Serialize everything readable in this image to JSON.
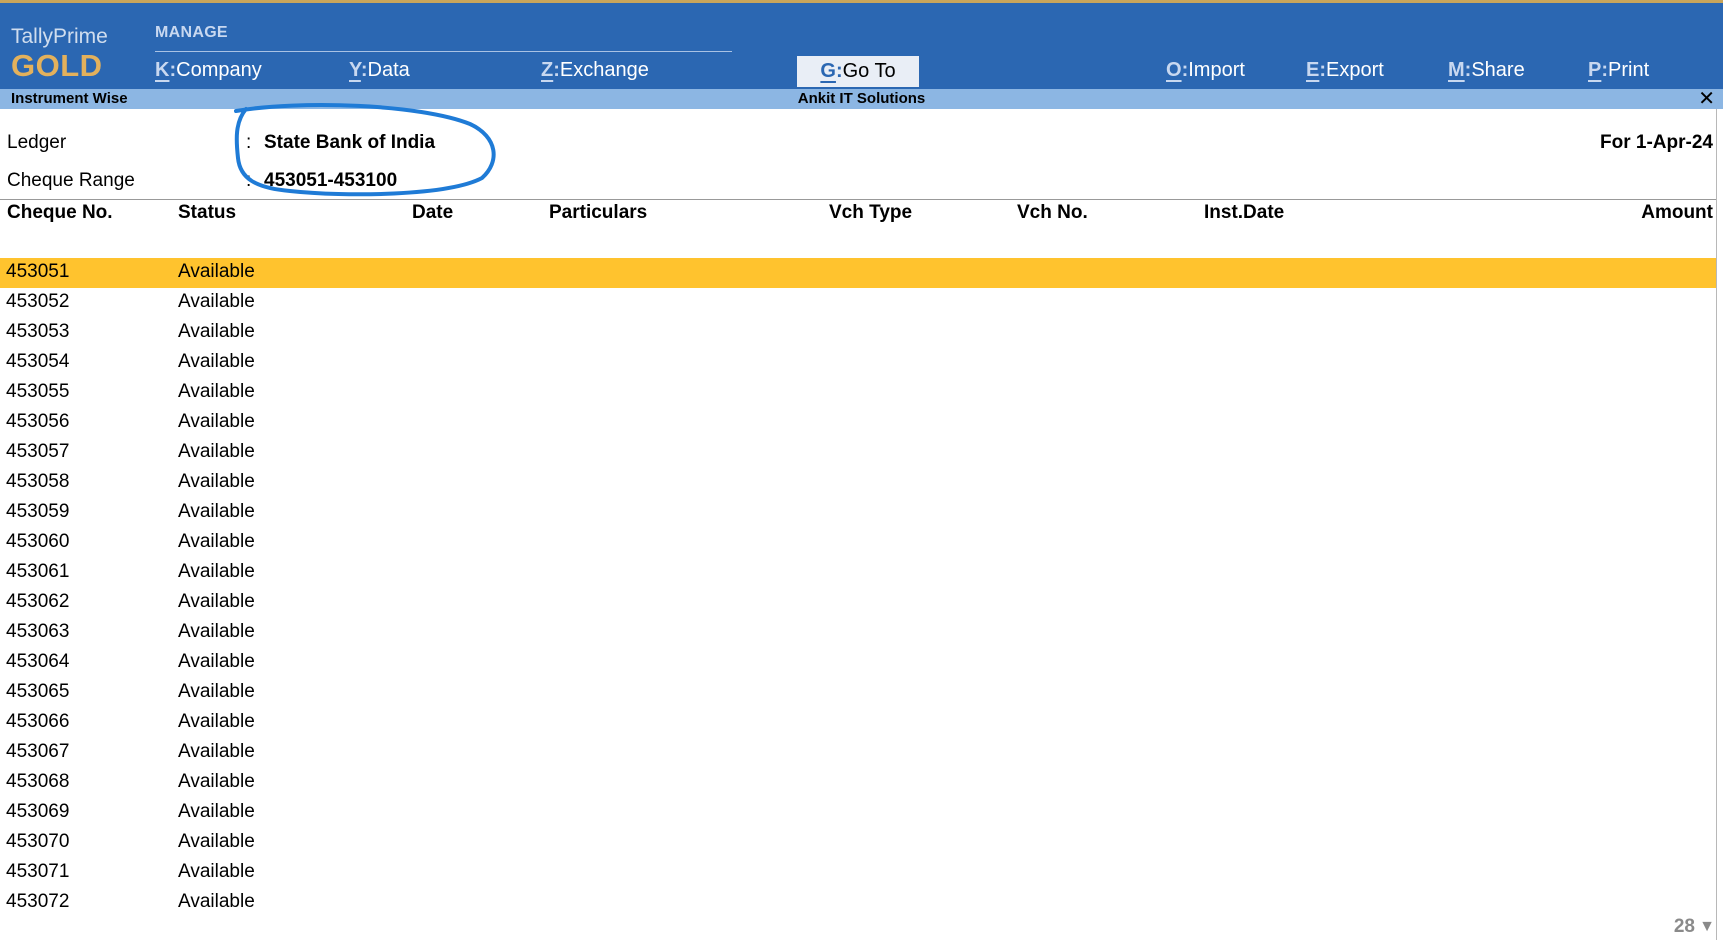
{
  "app": {
    "name": "TallyPrime",
    "edition": "GOLD"
  },
  "menu": {
    "section": "MANAGE",
    "items": [
      {
        "key": "K",
        "label": "Company"
      },
      {
        "key": "Y",
        "label": "Data"
      },
      {
        "key": "Z",
        "label": "Exchange"
      },
      {
        "key": "G",
        "label": "Go To"
      },
      {
        "key": "O",
        "label": "Import"
      },
      {
        "key": "E",
        "label": "Export"
      },
      {
        "key": "M",
        "label": "Share"
      },
      {
        "key": "P",
        "label": "Print"
      }
    ]
  },
  "subbar": {
    "report": "Instrument Wise",
    "company": "Ankit IT Solutions",
    "close": "✕"
  },
  "info": {
    "ledger_label": "Ledger",
    "ledger_value": "State Bank of India",
    "range_label": "Cheque Range",
    "range_value": "453051-453100",
    "sep": ":",
    "period": "For 1-Apr-24"
  },
  "columns": [
    "Cheque No.",
    "Status",
    "Date",
    "Particulars",
    "Vch Type",
    "Vch No.",
    "Inst.Date",
    "Amount"
  ],
  "rows": [
    {
      "cheque": "453051",
      "status": "Available"
    },
    {
      "cheque": "453052",
      "status": "Available"
    },
    {
      "cheque": "453053",
      "status": "Available"
    },
    {
      "cheque": "453054",
      "status": "Available"
    },
    {
      "cheque": "453055",
      "status": "Available"
    },
    {
      "cheque": "453056",
      "status": "Available"
    },
    {
      "cheque": "453057",
      "status": "Available"
    },
    {
      "cheque": "453058",
      "status": "Available"
    },
    {
      "cheque": "453059",
      "status": "Available"
    },
    {
      "cheque": "453060",
      "status": "Available"
    },
    {
      "cheque": "453061",
      "status": "Available"
    },
    {
      "cheque": "453062",
      "status": "Available"
    },
    {
      "cheque": "453063",
      "status": "Available"
    },
    {
      "cheque": "453064",
      "status": "Available"
    },
    {
      "cheque": "453065",
      "status": "Available"
    },
    {
      "cheque": "453066",
      "status": "Available"
    },
    {
      "cheque": "453067",
      "status": "Available"
    },
    {
      "cheque": "453068",
      "status": "Available"
    },
    {
      "cheque": "453069",
      "status": "Available"
    },
    {
      "cheque": "453070",
      "status": "Available"
    },
    {
      "cheque": "453071",
      "status": "Available"
    },
    {
      "cheque": "453072",
      "status": "Available"
    }
  ],
  "pager": {
    "count": "28",
    "arrow": "▼"
  },
  "colors": {
    "header_bg": "#2b67b2",
    "subbar_bg": "#8cb6e3",
    "selected_row": "#ffc32e",
    "annotation": "#1f7bd6",
    "edition": "#e3b15c"
  }
}
